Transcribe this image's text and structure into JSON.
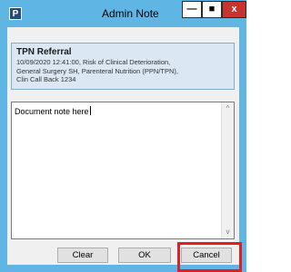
{
  "window": {
    "title": "Admin Note",
    "app_icon_letter": "P",
    "controls": {
      "minimize": "—",
      "maximize": "■",
      "close": "x"
    }
  },
  "header": {
    "title": "TPN Referral",
    "lines": [
      "10/09/2020 12:41:00, Risk of Clinical Deterioration,",
      "General Surgery SH, Parenteral Nutrition (PPN/TPN),",
      "Clin Call Back 1234"
    ]
  },
  "note": {
    "value": "Document note here",
    "scroll_up": "^",
    "scroll_down": "v"
  },
  "buttons": {
    "clear": "Clear",
    "ok": "OK",
    "cancel": "Cancel"
  },
  "colors": {
    "titlebar": "#5fb5e3",
    "close_button": "#c7342c",
    "header_panel": "#dbe7f3",
    "highlight": "#e02020"
  }
}
